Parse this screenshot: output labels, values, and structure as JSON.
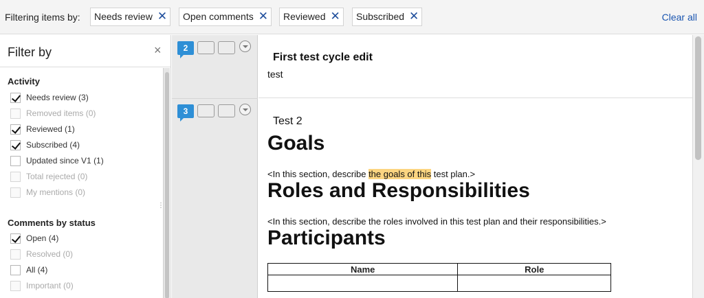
{
  "filter_bar": {
    "label": "Filtering items by:",
    "chips": [
      {
        "label": "Needs review"
      },
      {
        "label": "Open comments"
      },
      {
        "label": "Reviewed"
      },
      {
        "label": "Subscribed"
      }
    ],
    "remove_glyph": "✕",
    "clear_all": "Clear all"
  },
  "sidebar": {
    "title": "Filter by",
    "close_glyph": "×",
    "activity": {
      "title": "Activity",
      "options": [
        {
          "label": "Needs review (3)",
          "checked": true,
          "disabled": false
        },
        {
          "label": "Removed items (0)",
          "checked": false,
          "disabled": true
        },
        {
          "label": "Reviewed (1)",
          "checked": true,
          "disabled": false
        },
        {
          "label": "Subscribed (4)",
          "checked": true,
          "disabled": false
        },
        {
          "label": "Updated since V1 (1)",
          "checked": false,
          "disabled": false
        },
        {
          "label": "Total rejected (0)",
          "checked": false,
          "disabled": true
        },
        {
          "label": "My mentions (0)",
          "checked": false,
          "disabled": true
        }
      ]
    },
    "comments": {
      "title": "Comments by status",
      "options": [
        {
          "label": "Open (4)",
          "checked": true,
          "disabled": false
        },
        {
          "label": "Resolved (0)",
          "checked": false,
          "disabled": true
        },
        {
          "label": "All (4)",
          "checked": false,
          "disabled": false
        },
        {
          "label": "Important (0)",
          "checked": false,
          "disabled": true
        }
      ]
    }
  },
  "gutter": {
    "items": [
      {
        "badge": "2"
      },
      {
        "badge": "3"
      }
    ]
  },
  "content": {
    "section1": {
      "heading": "First test cycle edit",
      "body": "test"
    },
    "section2": {
      "subtitle": "Test 2",
      "goals_heading": "Goals",
      "goals_text_before": "<In this section, describe ",
      "goals_text_highlight": "the goals of this",
      "goals_text_after": " test plan.>",
      "roles_heading": "Roles and Responsibilities",
      "roles_text": "<In this section, describe the roles involved in this test plan and their responsibilities.>",
      "participants_heading": "Participants",
      "table_headers": [
        "Name",
        "Role"
      ]
    }
  },
  "colors": {
    "accent_link": "#1a55b0",
    "badge": "#2e8fd6",
    "highlight": "#fcd581"
  }
}
